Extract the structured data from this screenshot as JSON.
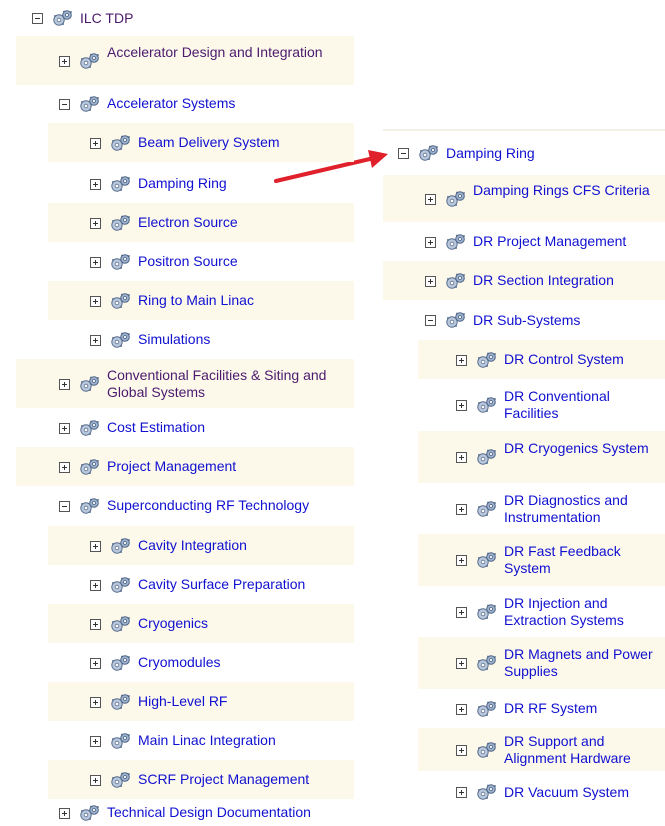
{
  "colors": {
    "link": "#1010d0",
    "visited_link": "#4b1a6e",
    "row_shade": "#fcf8ea",
    "arrow": "#e0202a"
  },
  "left_tree": {
    "root": {
      "label": "ILC TDP",
      "expanded": true,
      "icon": "gears-icon"
    },
    "items": [
      {
        "label": "Accelerator Design and Integration",
        "expanded": false,
        "level": 1
      },
      {
        "label": "Accelerator Systems",
        "expanded": true,
        "level": 1
      },
      {
        "label": "Beam Delivery System",
        "expanded": false,
        "level": 2
      },
      {
        "label": "Damping Ring",
        "expanded": false,
        "level": 2
      },
      {
        "label": "Electron Source",
        "expanded": false,
        "level": 2
      },
      {
        "label": "Positron Source",
        "expanded": false,
        "level": 2
      },
      {
        "label": "Ring to Main Linac",
        "expanded": false,
        "level": 2
      },
      {
        "label": "Simulations",
        "expanded": false,
        "level": 2
      },
      {
        "label": "Conventional Facilities & Siting and Global Systems",
        "expanded": false,
        "level": 1
      },
      {
        "label": "Cost Estimation",
        "expanded": false,
        "level": 1
      },
      {
        "label": "Project Management",
        "expanded": false,
        "level": 1
      },
      {
        "label": "Superconducting RF Technology",
        "expanded": true,
        "level": 1
      },
      {
        "label": "Cavity Integration",
        "expanded": false,
        "level": 2
      },
      {
        "label": "Cavity Surface Preparation",
        "expanded": false,
        "level": 2
      },
      {
        "label": "Cryogenics",
        "expanded": false,
        "level": 2
      },
      {
        "label": "Cryomodules",
        "expanded": false,
        "level": 2
      },
      {
        "label": "High-Level RF",
        "expanded": false,
        "level": 2
      },
      {
        "label": "Main Linac Integration",
        "expanded": false,
        "level": 2
      },
      {
        "label": "SCRF Project Management",
        "expanded": false,
        "level": 2
      },
      {
        "label": "Technical Design Documentation",
        "expanded": false,
        "level": 1
      }
    ]
  },
  "right_tree": {
    "root": {
      "label": "Damping Ring",
      "expanded": true
    },
    "items": [
      {
        "label": "Damping Rings CFS Criteria",
        "expanded": false,
        "level": 1
      },
      {
        "label": "DR Project Management",
        "expanded": false,
        "level": 1
      },
      {
        "label": "DR Section Integration",
        "expanded": false,
        "level": 1
      },
      {
        "label": "DR Sub-Systems",
        "expanded": true,
        "level": 1
      },
      {
        "label": "DR Control System",
        "expanded": false,
        "level": 2
      },
      {
        "label": "DR Conventional Facilities",
        "expanded": false,
        "level": 2
      },
      {
        "label": "DR Cryogenics System",
        "expanded": false,
        "level": 2
      },
      {
        "label": "DR Diagnostics and Instrumentation",
        "expanded": false,
        "level": 2
      },
      {
        "label": "DR Fast Feedback System",
        "expanded": false,
        "level": 2
      },
      {
        "label": "DR Injection and Extraction Systems",
        "expanded": false,
        "level": 2
      },
      {
        "label": "DR Magnets and Power Supplies",
        "expanded": false,
        "level": 2
      },
      {
        "label": "DR RF System",
        "expanded": false,
        "level": 2
      },
      {
        "label": "DR Support and Alignment Hardware",
        "expanded": false,
        "level": 2
      },
      {
        "label": "DR Vacuum System",
        "expanded": false,
        "level": 2
      }
    ]
  }
}
